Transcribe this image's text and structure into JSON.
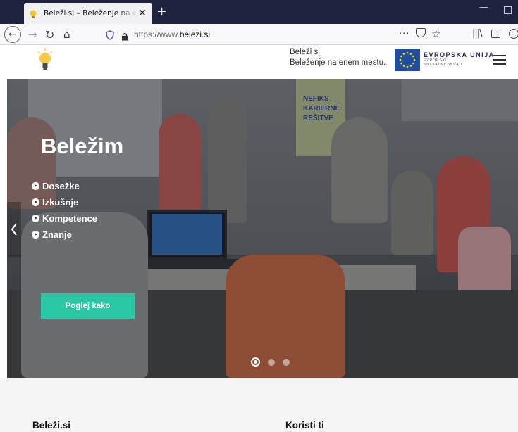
{
  "browser": {
    "tab_title": "Beleži.si – Beleženje na enem mestu",
    "tab_close": "✕",
    "new_tab": "+",
    "url_prefix": "https://www.",
    "url_domain": "belezi.si",
    "page_actions": "···"
  },
  "header": {
    "slogan_line1": "Beleži si!",
    "slogan_line2": "Beleženje na enem mestu.",
    "eu_title": "EVROPSKA UNIJA",
    "eu_sub1": "EVROPSKI",
    "eu_sub2": "SOCIALNI SKLAD"
  },
  "hero": {
    "title": "Beležim",
    "items": [
      "Dosežke",
      "Izkušnje",
      "Kompetence",
      "Znanje"
    ],
    "cta": "Poglej kako",
    "banner_text": [
      "NEFIKS",
      "KARIERNE",
      "REŠITVE"
    ]
  },
  "sections": {
    "left_title": "Beleži.si",
    "right_title": "Koristi ti"
  },
  "colors": {
    "accent": "#2bc6a4",
    "titlebar": "#202340"
  }
}
